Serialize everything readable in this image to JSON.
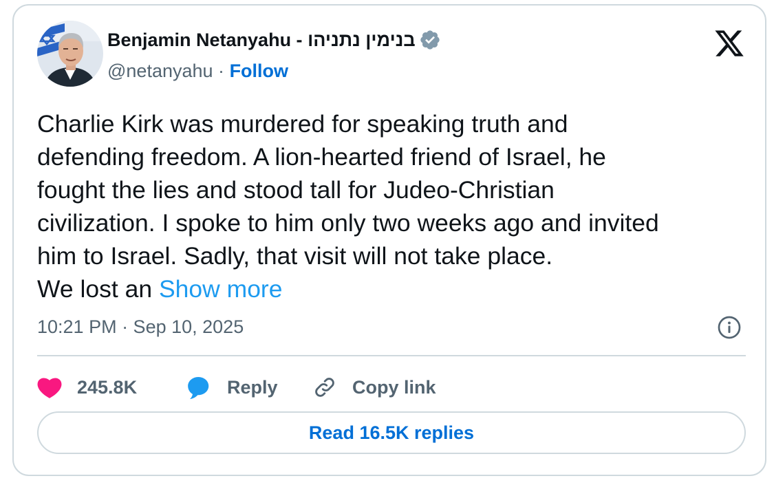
{
  "author": {
    "display_name": "Benjamin Netanyahu - בנימין נתניהו",
    "handle": "@netanyahu",
    "separator": "·",
    "follow_label": "Follow",
    "verified": true
  },
  "tweet": {
    "lines": [
      "Charlie Kirk was murdered for speaking truth and",
      "defending freedom. A lion-hearted friend of Israel, he",
      "fought the lies and stood tall for Judeo-Christian",
      "civilization. I spoke to him only two weeks ago and invited",
      "him to Israel. Sadly, that visit will not take place."
    ],
    "last_line": "We lost an",
    "show_more_label": "Show more",
    "timestamp": "10:21 PM · Sep 10, 2025"
  },
  "actions": {
    "like_count": "245.8K",
    "reply_label": "Reply",
    "copy_link_label": "Copy link"
  },
  "read_replies_label": "Read 16.5K replies",
  "icons": {
    "logo": "x-logo-icon",
    "verified": "verified-badge-icon",
    "info": "info-icon",
    "like": "heart-icon",
    "reply": "reply-bubble-icon",
    "copy_link": "link-icon"
  },
  "colors": {
    "link_blue": "#006fd6",
    "show_more_blue": "#1d9bf0",
    "like_pink": "#f91880",
    "secondary_text": "#536471",
    "border": "#cfd9de",
    "verified_gray": "#829aab"
  }
}
